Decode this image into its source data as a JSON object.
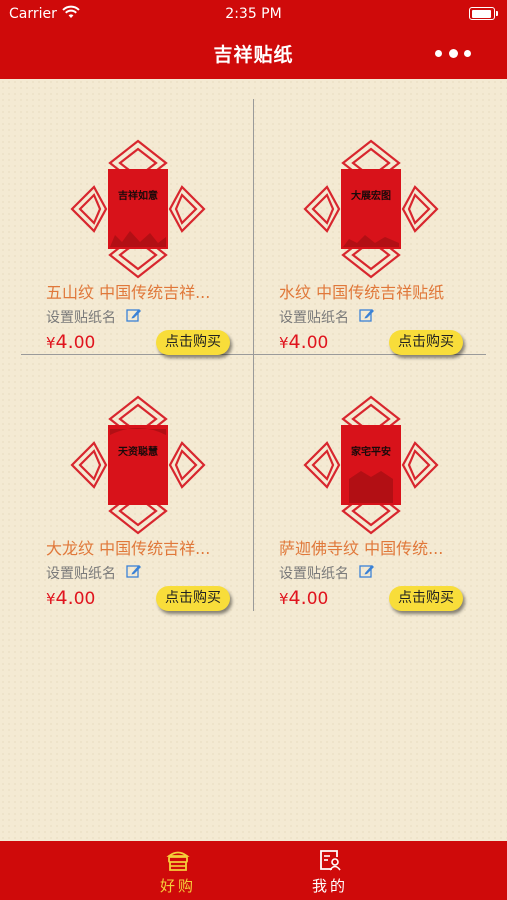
{
  "status_bar": {
    "carrier": "Carrier",
    "time": "2:35 PM"
  },
  "nav": {
    "title": "吉祥贴纸",
    "more_icon": "more-dots-icon"
  },
  "products": [
    {
      "name": "五山纹  中国传统吉祥...",
      "sticker_text": "吉祥如意",
      "set_name": "设置贴纸名",
      "currency": "¥",
      "price_main": "4.",
      "price_cents": "00",
      "buy_label": "点击购买"
    },
    {
      "name": "水纹  中国传统吉祥贴纸",
      "sticker_text": "大展宏图",
      "set_name": "设置贴纸名",
      "currency": "¥",
      "price_main": "4.",
      "price_cents": "00",
      "buy_label": "点击购买"
    },
    {
      "name": "大龙纹  中国传统吉祥...",
      "sticker_text": "天资聪慧",
      "set_name": "设置贴纸名",
      "currency": "¥",
      "price_main": "4.",
      "price_cents": "00",
      "buy_label": "点击购买"
    },
    {
      "name": "萨迦佛寺纹  中国传统...",
      "sticker_text": "家宅平安",
      "set_name": "设置贴纸名",
      "currency": "¥",
      "price_main": "4.",
      "price_cents": "00",
      "buy_label": "点击购买"
    }
  ],
  "tabs": [
    {
      "label": "好购",
      "icon": "shop-icon",
      "active": true
    },
    {
      "label": "我的",
      "icon": "profile-icon",
      "active": false
    }
  ],
  "colors": {
    "brand_red": "#cf0a0a",
    "price_red": "#e0141e",
    "name_orange": "#e0783a",
    "buy_yellow": "#f8dd3a",
    "active_tab": "#f5cf3a"
  }
}
